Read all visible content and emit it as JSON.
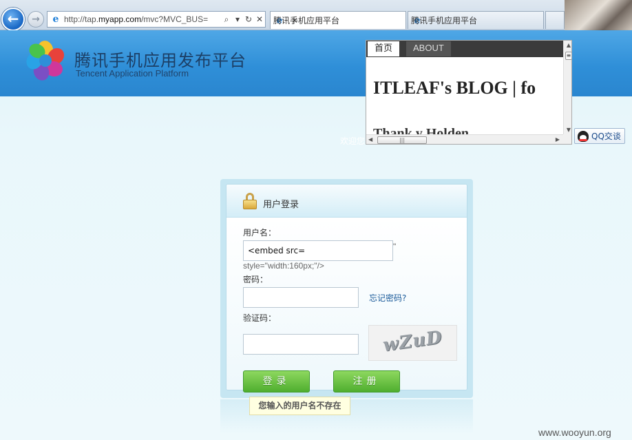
{
  "browser": {
    "url_prefix": "http://tap.",
    "url_domain": "myapp.com",
    "url_suffix": "/mvc?MVC_BUS=",
    "tabs": [
      {
        "label": "腾讯手机应用平台",
        "close": "✕"
      },
      {
        "label": "腾讯手机应用平台"
      }
    ]
  },
  "site": {
    "title": "腾讯手机应用发布平台",
    "subtitle": "Tencent Application Platform",
    "welcome": "欢迎您",
    "qq_button": "QQ交谈"
  },
  "embed": {
    "nav": [
      "首页",
      "ABOUT"
    ],
    "heading": "ITLEAF's BLOG | fo",
    "subheading": "Thank y Holden"
  },
  "login": {
    "title": "用户登录",
    "username_label": "用户名：",
    "username_value": "<embed src=",
    "username_leak_quote": "\"",
    "username_leak_style": "style=\"width:160px;\"/>",
    "password_label": "密码：",
    "forgot_link": "忘记密码?",
    "captcha_label": "验证码：",
    "captcha_text": "wZuD",
    "login_button": "登录",
    "register_button": "注册",
    "error_message": "您输入的用户名不存在"
  },
  "watermark": "www.wooyun.org",
  "colors": {
    "header_blue": "#2f8fd8",
    "button_green": "#4fae2f",
    "link_blue": "#1a5a9a"
  }
}
